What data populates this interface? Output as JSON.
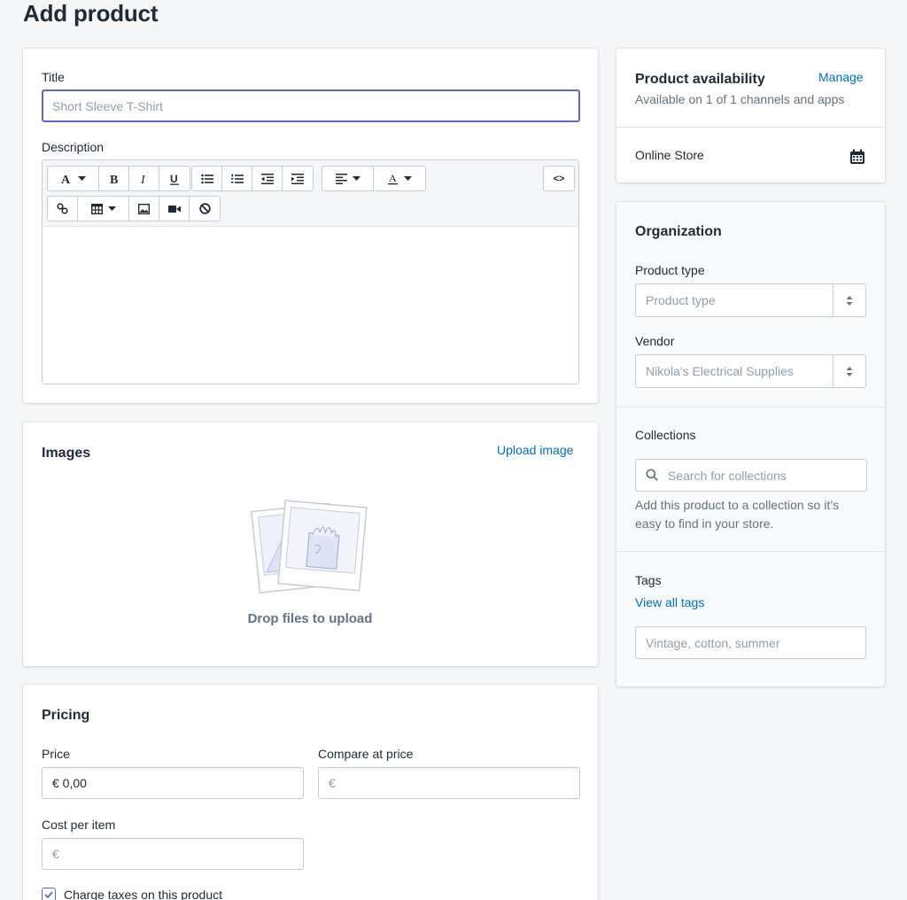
{
  "page": {
    "title": "Add product"
  },
  "product": {
    "title_label": "Title",
    "title_placeholder": "Short Sleeve T-Shirt",
    "description_label": "Description",
    "toolbar": {
      "html_button": "<>"
    }
  },
  "images": {
    "heading": "Images",
    "upload_link": "Upload image",
    "drop_text": "Drop files to upload"
  },
  "pricing": {
    "heading": "Pricing",
    "price_label": "Price",
    "price_value": "€ 0,00",
    "compare_label": "Compare at price",
    "compare_placeholder": "€",
    "cost_label": "Cost per item",
    "cost_placeholder": "€",
    "charge_taxes_label": "Charge taxes on this product",
    "charge_taxes_checked": true
  },
  "availability": {
    "heading": "Product availability",
    "manage_link": "Manage",
    "subtitle": "Available on 1 of 1 channels and apps",
    "channel": "Online Store"
  },
  "organization": {
    "heading": "Organization",
    "product_type_label": "Product type",
    "product_type_placeholder": "Product type",
    "vendor_label": "Vendor",
    "vendor_placeholder": "Nikola's Electrical Supplies",
    "collections_label": "Collections",
    "collections_placeholder": "Search for collections",
    "collections_help_1": "Add this product to a collection so it’s",
    "collections_help_2": "easy to find in your store.",
    "tags_label": "Tags",
    "view_all_tags": "View all tags",
    "tags_placeholder": "Vintage, cotton, summer"
  },
  "colors": {
    "accent": "#5c6ac4",
    "link": "#006fbb",
    "border": "#c4cdd5",
    "background": "#f4f6f8"
  }
}
